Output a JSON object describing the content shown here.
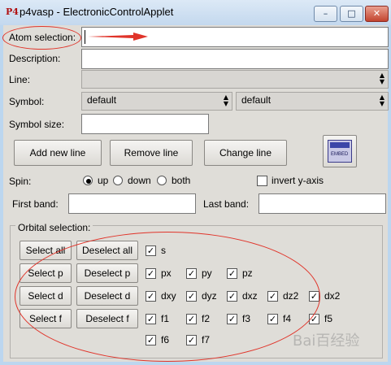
{
  "window": {
    "title": "p4vasp - ElectronicControlApplet",
    "app_icon": "P4",
    "minimize_glyph": "–",
    "maximize_glyph": "□",
    "close_glyph": "✕"
  },
  "form": {
    "atom_selection_label": "Atom selection:",
    "atom_selection_value": "",
    "description_label": "Description:",
    "description_value": "",
    "line_label": "Line:",
    "line_value": "",
    "symbol_label": "Symbol:",
    "symbol_value_1": "default",
    "symbol_value_2": "default",
    "symbol_size_label": "Symbol size:",
    "symbol_size_value": ""
  },
  "buttons": {
    "add_new_line": "Add new line",
    "remove_line": "Remove line",
    "change_line": "Change line",
    "embed_icon_text": "EMBED"
  },
  "spin": {
    "label": "Spin:",
    "up": "up",
    "down": "down",
    "both": "both",
    "selected": "up",
    "invert_label": "invert y-axis",
    "invert_checked": false
  },
  "bands": {
    "first_label": "First band:",
    "first_value": "",
    "last_label": "Last band:",
    "last_value": ""
  },
  "orbital": {
    "legend": "Orbital selection:",
    "select_all": "Select all",
    "deselect_all": "Deselect all",
    "select_p": "Select p",
    "deselect_p": "Deselect p",
    "select_d": "Select d",
    "deselect_d": "Deselect d",
    "select_f": "Select f",
    "deselect_f": "Deselect f",
    "s": "s",
    "px": "px",
    "py": "py",
    "pz": "pz",
    "dxy": "dxy",
    "dyz": "dyz",
    "dxz": "dxz",
    "dz2": "dz2",
    "dx2": "dx2",
    "f1": "f1",
    "f2": "f2",
    "f3": "f3",
    "f4": "f4",
    "f5": "f5",
    "f6": "f6",
    "f7": "f7",
    "check_glyph": "✓"
  },
  "accents": {
    "annotation_red": "#e0342a"
  },
  "watermark": "Bai百经验"
}
